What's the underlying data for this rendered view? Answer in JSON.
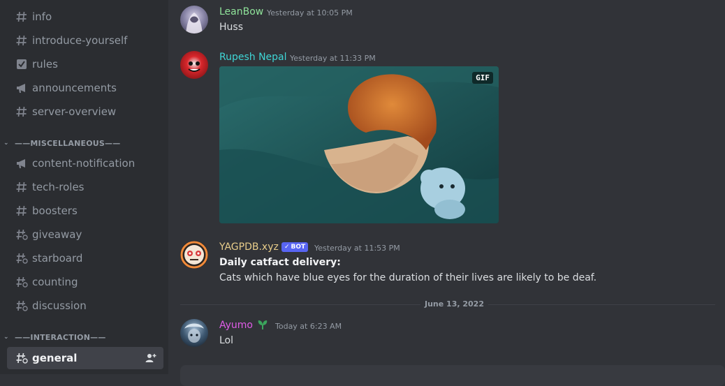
{
  "sidebar": {
    "channels_top": [
      {
        "icon": "hash-icon",
        "label": "info"
      },
      {
        "icon": "hash-icon",
        "label": "introduce-yourself"
      },
      {
        "icon": "checkbox-icon",
        "label": "rules"
      },
      {
        "icon": "megaphone-icon",
        "label": "announcements"
      },
      {
        "icon": "hash-icon",
        "label": "server-overview"
      }
    ],
    "category_misc": "——MISCELLANEOUS——",
    "channels_misc": [
      {
        "icon": "megaphone-icon",
        "label": "content-notification"
      },
      {
        "icon": "hash-icon",
        "label": "tech-roles"
      },
      {
        "icon": "hash-icon",
        "label": "boosters"
      },
      {
        "icon": "hash-thread-icon",
        "label": "giveaway"
      },
      {
        "icon": "hash-thread-icon",
        "label": "starboard"
      },
      {
        "icon": "hash-thread-icon",
        "label": "counting"
      },
      {
        "icon": "hash-thread-icon",
        "label": "discussion"
      }
    ],
    "category_interaction": "——INTERACTION——",
    "active_channel": {
      "icon": "hash-thread-icon",
      "label": "general"
    }
  },
  "messages": [
    {
      "author": "LeanBow",
      "color": "#8fe39a",
      "timestamp": "Yesterday at 10:05 PM",
      "text": "Huss"
    },
    {
      "author": "Rupesh Nepal",
      "color": "#3fd6d6",
      "timestamp": "Yesterday at 11:33 PM",
      "gif_badge": "GIF"
    },
    {
      "author": "YAGPDB.xyz",
      "color": "#e8cd8a",
      "bot_badge": "BOT",
      "timestamp": "Yesterday at 11:53 PM",
      "title": "Daily catfact delivery:",
      "text": "Cats which have blue eyes for the duration of their lives are likely to be deaf."
    },
    {
      "author": "Ayumo",
      "color": "#e05ce8",
      "timestamp": "Today at 6:23 AM",
      "text": "Lol"
    }
  ],
  "date_divider": "June 13, 2022"
}
